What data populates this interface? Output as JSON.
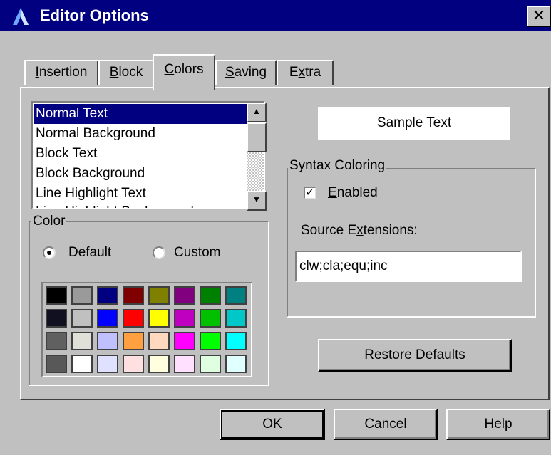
{
  "window": {
    "title": "Editor Options",
    "close_label": "✕",
    "icon": "app-icon"
  },
  "tabs": [
    {
      "label": "Insertion",
      "mnemonic": "I",
      "rest": "nsertion"
    },
    {
      "label": "Block",
      "mnemonic": "B",
      "rest": "lock"
    },
    {
      "label": "Colors",
      "mnemonic": "C",
      "rest": "olors",
      "active": true
    },
    {
      "label": "Saving",
      "mnemonic": "S",
      "rest": "aving"
    },
    {
      "label": "Extra",
      "pre": "E",
      "mnemonic": "x",
      "rest": "tra"
    }
  ],
  "color_items": {
    "items": [
      "Normal Text",
      "Normal Background",
      "Block Text",
      "Block Background",
      "Line Highlight Text",
      "Line Highlight Background"
    ],
    "selected_index": 0
  },
  "color_group": {
    "legend": "Color",
    "radio_default": "Default",
    "radio_custom": "Custom",
    "selected": "Default"
  },
  "palette": {
    "colors": [
      "#000000",
      "#9a9a9a",
      "#000080",
      "#800000",
      "#808000",
      "#800080",
      "#008000",
      "#008080",
      "#101020",
      "#c0c0c0",
      "#0000ff",
      "#ff0000",
      "#ffff00",
      "#c000c0",
      "#00c000",
      "#00c8c8",
      "#606060",
      "#e0e0d8",
      "#c0c0ff",
      "#ffa040",
      "#ffd8c0",
      "#ff00ff",
      "#00ff00",
      "#00ffff",
      "#585858",
      "#ffffff",
      "#e0e0ff",
      "#ffe0e0",
      "#ffffe0",
      "#ffe0ff",
      "#e0ffe0",
      "#e0ffff"
    ]
  },
  "sample_text": "Sample Text",
  "syntax": {
    "legend": "Syntax Coloring",
    "enabled_mnemonic": "E",
    "enabled_rest": "nabled",
    "enabled_checked": true,
    "enabled_mark": "✓",
    "ext_label_pre": "Source E",
    "ext_label_mnemonic": "x",
    "ext_label_rest": "tensions:",
    "ext_value": "clw;cla;equ;inc"
  },
  "buttons": {
    "restore": "Restore Defaults",
    "ok_mnemonic": "O",
    "ok_rest": "K",
    "cancel": "Cancel",
    "help_mnemonic": "H",
    "help_rest": "elp"
  }
}
